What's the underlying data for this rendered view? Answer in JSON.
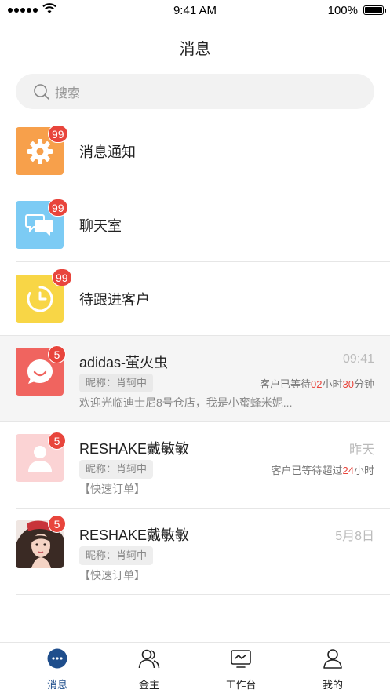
{
  "status_bar": {
    "time": "9:41 AM",
    "battery": "100%"
  },
  "header": {
    "title": "消息"
  },
  "search": {
    "placeholder": "搜索"
  },
  "system_items": [
    {
      "label": "消息通知",
      "badge": "99",
      "icon": "gear-icon",
      "color": "#f7a04b"
    },
    {
      "label": "聊天室",
      "badge": "99",
      "icon": "chat-bubbles-icon",
      "color": "#7ccbf4"
    },
    {
      "label": "待跟进客户",
      "badge": "99",
      "icon": "clock-icon",
      "color": "#f8d646"
    }
  ],
  "chats": [
    {
      "name": "adidas-萤火虫",
      "time": "09:41",
      "nickname": "昵称：肖轲中",
      "badge": "5",
      "wait_prefix": "客户已等待",
      "wait_hours": "02",
      "wait_hours_unit": "小时",
      "wait_minutes": "30",
      "wait_minutes_unit": "分钟",
      "preview": "欢迎光临迪士尼8号仓店，我是小蜜蜂米妮...",
      "avatar": "smile-face-icon",
      "color": "#f0645f"
    },
    {
      "name": "RESHAKE戴敏敏",
      "time": "昨天",
      "nickname": "昵称：肖轲中",
      "badge": "5",
      "wait_prefix": "客户已等待超过",
      "wait_hours": "24",
      "wait_hours_unit": "小时",
      "preview": "【快速订单】",
      "avatar": "person-icon",
      "color": "#fbd3d4"
    },
    {
      "name": "RESHAKE戴敏敏",
      "time": "5月8日",
      "nickname": "昵称：肖轲中",
      "badge": "5",
      "preview": "【快速订单】",
      "avatar": "photo-avatar"
    }
  ],
  "tabs": [
    {
      "label": "消息",
      "icon": "message-bubble-icon",
      "active": true
    },
    {
      "label": "金主",
      "icon": "users-icon"
    },
    {
      "label": "工作台",
      "icon": "monitor-icon"
    },
    {
      "label": "我的",
      "icon": "user-icon"
    }
  ],
  "colors": {
    "accent": "#1f4e8c",
    "badge": "#e8453c"
  }
}
